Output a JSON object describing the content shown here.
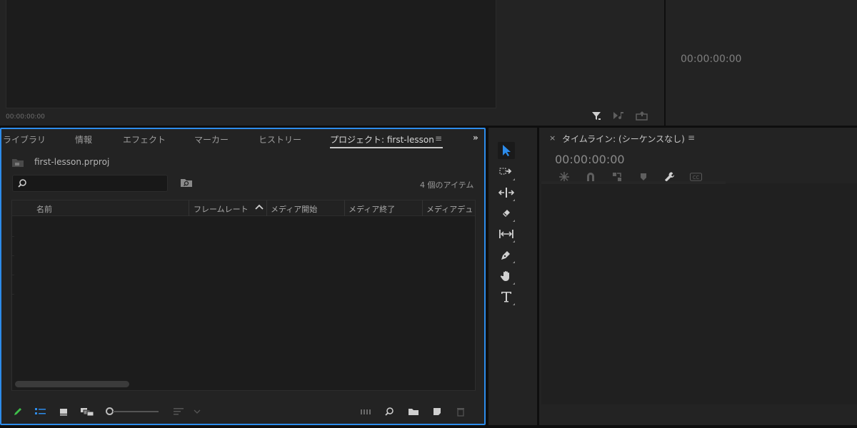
{
  "source_monitor": {
    "timecode": "00:00:00:00",
    "buttons": [
      "filter-icon",
      "insert-audio-icon",
      "export-frame-icon"
    ]
  },
  "program_monitor": {
    "timecode": "00:00:00:00"
  },
  "project_panel": {
    "tabs": [
      {
        "label": "ライブラリ"
      },
      {
        "label": "情報"
      },
      {
        "label": "エフェクト"
      },
      {
        "label": "マーカー"
      },
      {
        "label": "ヒストリー"
      },
      {
        "label": "プロジェクト: first-lesson",
        "active": true
      }
    ],
    "project_file": "first-lesson.prproj",
    "search": {
      "value": "",
      "placeholder": ""
    },
    "item_count": "4 個のアイテム",
    "columns": [
      "名前",
      "フレームレート",
      "メディア開始",
      "メディア終了",
      "メディアデュ"
    ],
    "accent_color": "#2d8ceb"
  },
  "tools": [
    "selection-tool-icon",
    "track-select-icon",
    "ripple-edit-icon",
    "razor-tool-icon",
    "slip-tool-icon",
    "pen-tool-icon",
    "hand-tool-icon",
    "type-tool-icon"
  ],
  "timeline": {
    "title": "タイムライン: (シーケンスなし)",
    "close": "×",
    "timecode": "00:00:00:00",
    "tools": [
      "snap-icon",
      "magnet-icon",
      "linked-selection-icon",
      "marker-icon",
      "wrench-icon",
      "captions-icon"
    ],
    "captions_label": "CC"
  }
}
